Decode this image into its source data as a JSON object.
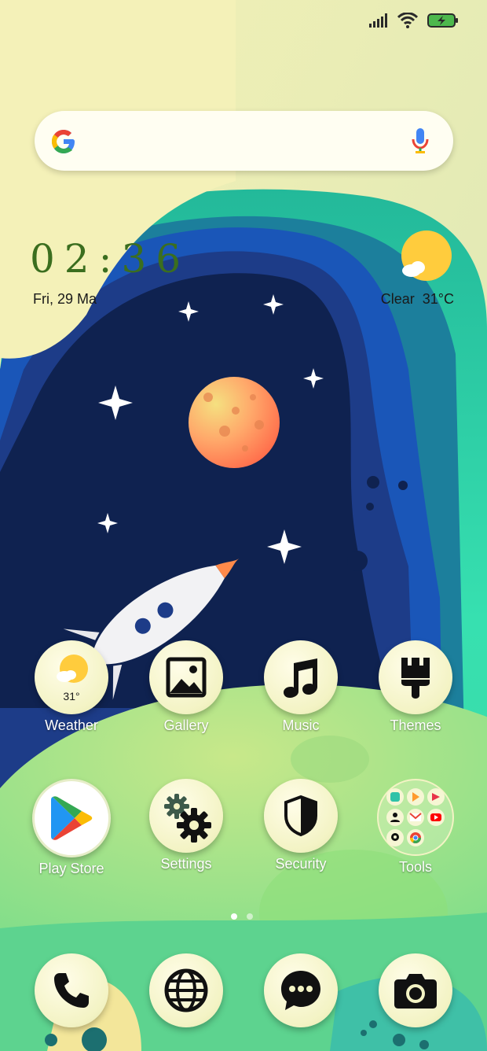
{
  "status_bar": {
    "icons": [
      "signal-icon",
      "wifi-icon",
      "battery-charging-icon"
    ]
  },
  "search": {
    "logo": "google-logo",
    "mic_icon": "mic-icon"
  },
  "clock": {
    "time": "02:36",
    "date": "Fri, 29 Ma"
  },
  "weather_widget": {
    "condition": "Clear",
    "temperature": "31°C",
    "icon": "sun-cloud-icon"
  },
  "apps_row1": [
    {
      "label": "Weather",
      "icon": "weather-icon",
      "badge": "31°"
    },
    {
      "label": "Gallery",
      "icon": "gallery-icon"
    },
    {
      "label": "Music",
      "icon": "music-note-icon"
    },
    {
      "label": "Themes",
      "icon": "brush-icon"
    }
  ],
  "apps_row2": [
    {
      "label": "Play Store",
      "icon": "play-store-icon"
    },
    {
      "label": "Settings",
      "icon": "gears-icon"
    },
    {
      "label": "Security",
      "icon": "shield-icon"
    },
    {
      "label": "Tools",
      "icon": "folder-icon"
    }
  ],
  "page_indicator": {
    "total": 2,
    "active": 1
  },
  "dock": [
    {
      "icon": "phone-icon"
    },
    {
      "icon": "globe-icon"
    },
    {
      "icon": "messages-icon"
    },
    {
      "icon": "camera-icon"
    }
  ],
  "colors": {
    "clock": "#3b6e1f",
    "icon_bg": "#f3f3c4",
    "deep_space": "#0f2250",
    "teal": "#2ed7a9",
    "planet": "#ff8c5a"
  }
}
